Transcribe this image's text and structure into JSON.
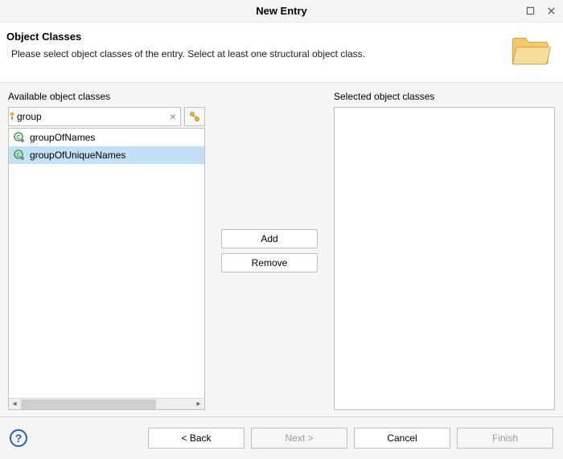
{
  "window": {
    "title": "New Entry"
  },
  "header": {
    "title": "Object Classes",
    "description": "Please select object classes of the entry. Select at least one structural object class."
  },
  "available": {
    "label": "Available object classes",
    "filter_value": "group",
    "items": [
      "groupOfNames",
      "groupOfUniqueNames"
    ],
    "selected_index": 1
  },
  "selected": {
    "label": "Selected object classes",
    "items": []
  },
  "buttons": {
    "add": "Add",
    "remove": "Remove",
    "back": "< Back",
    "next": "Next >",
    "cancel": "Cancel",
    "finish": "Finish"
  }
}
